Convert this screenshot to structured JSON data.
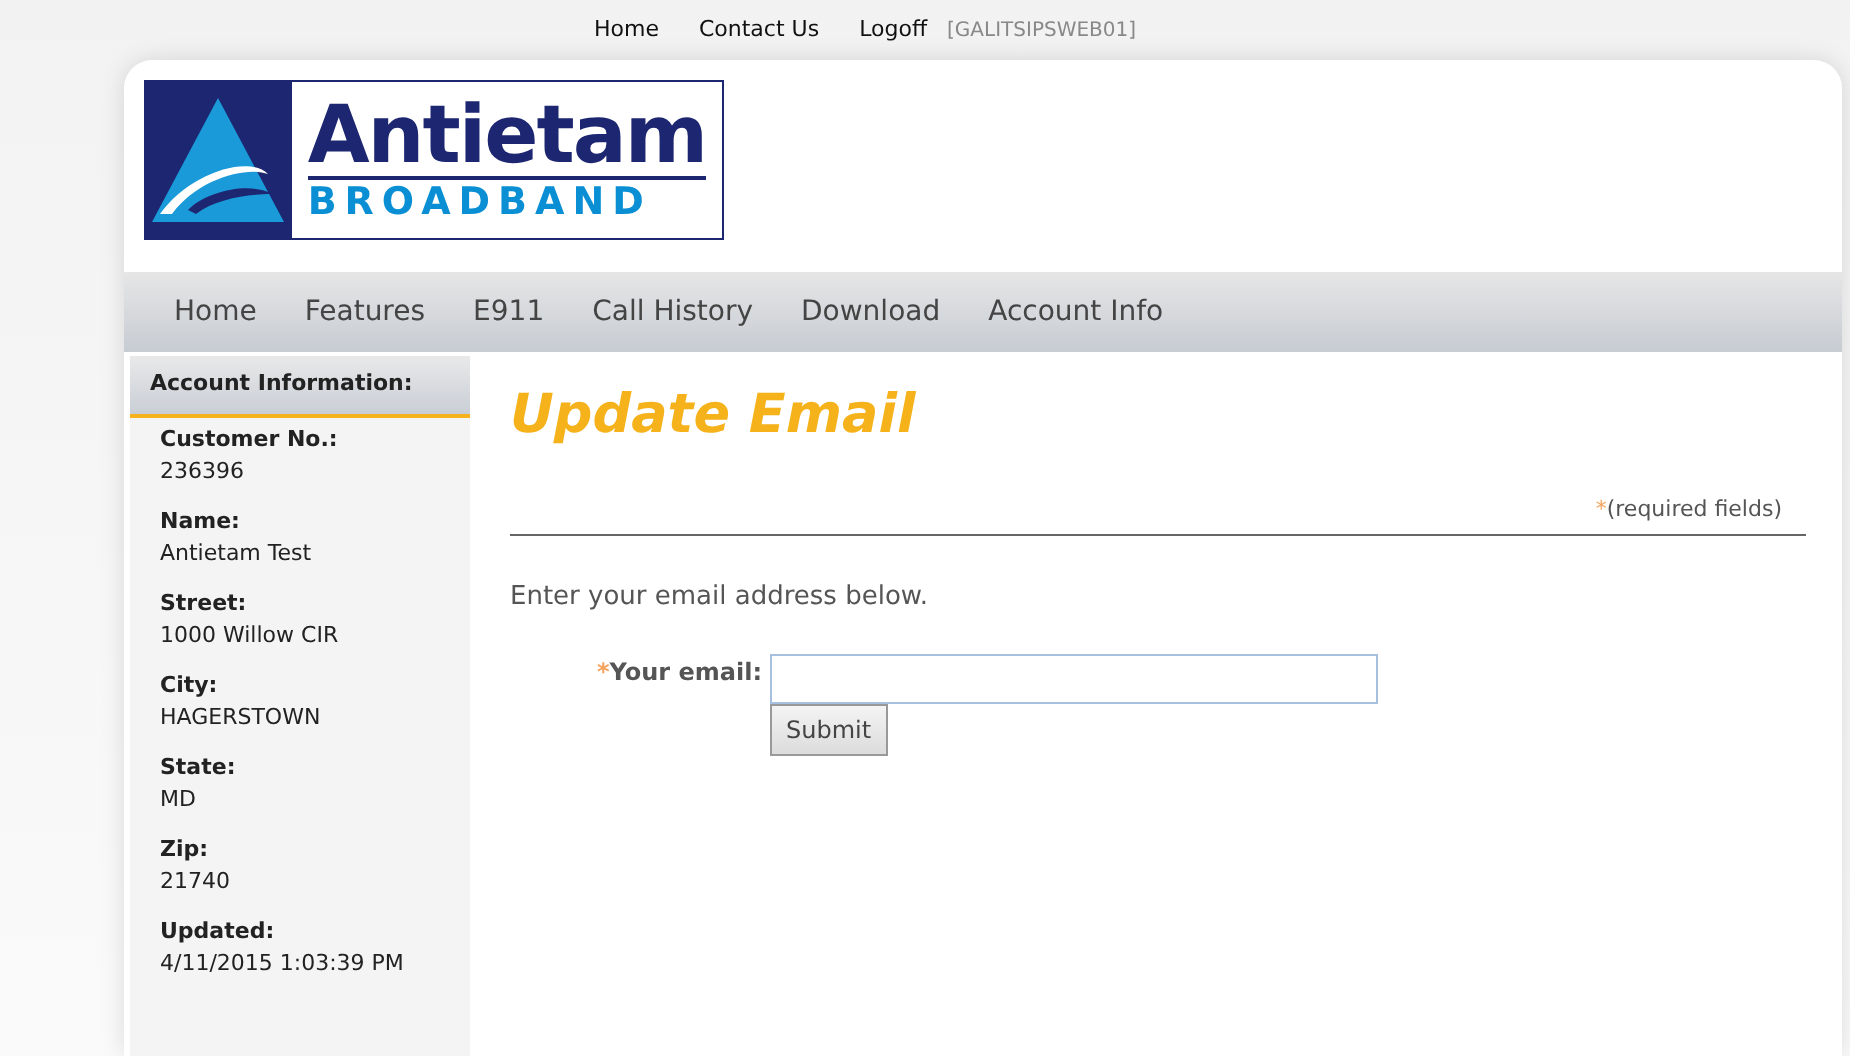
{
  "top_links": [
    "Home",
    "Contact Us",
    "Logoff"
  ],
  "server": "[GALITSIPSWEB01]",
  "logo": {
    "name": "Antietam",
    "tagline": "BROADBAND"
  },
  "nav": [
    "Home",
    "Features",
    "E911",
    "Call History",
    "Download",
    "Account Info"
  ],
  "sidebar": {
    "title": "Account Information:",
    "fields": [
      {
        "label": "Customer No.:",
        "value": "236396"
      },
      {
        "label": "Name:",
        "value": "Antietam Test"
      },
      {
        "label": "Street:",
        "value": "1000 Willow CIR"
      },
      {
        "label": "City:",
        "value": "HAGERSTOWN"
      },
      {
        "label": "State:",
        "value": "MD"
      },
      {
        "label": "Zip:",
        "value": "21740"
      },
      {
        "label": "Updated:",
        "value": "4/11/2015 1:03:39 PM"
      }
    ]
  },
  "page_title": "Update Email",
  "required_note": {
    "mark": "*",
    "text": "(required fields)"
  },
  "instructions": "Enter your email address below.",
  "form": {
    "mark": "*",
    "label": "Your email:",
    "button": "Submit"
  }
}
